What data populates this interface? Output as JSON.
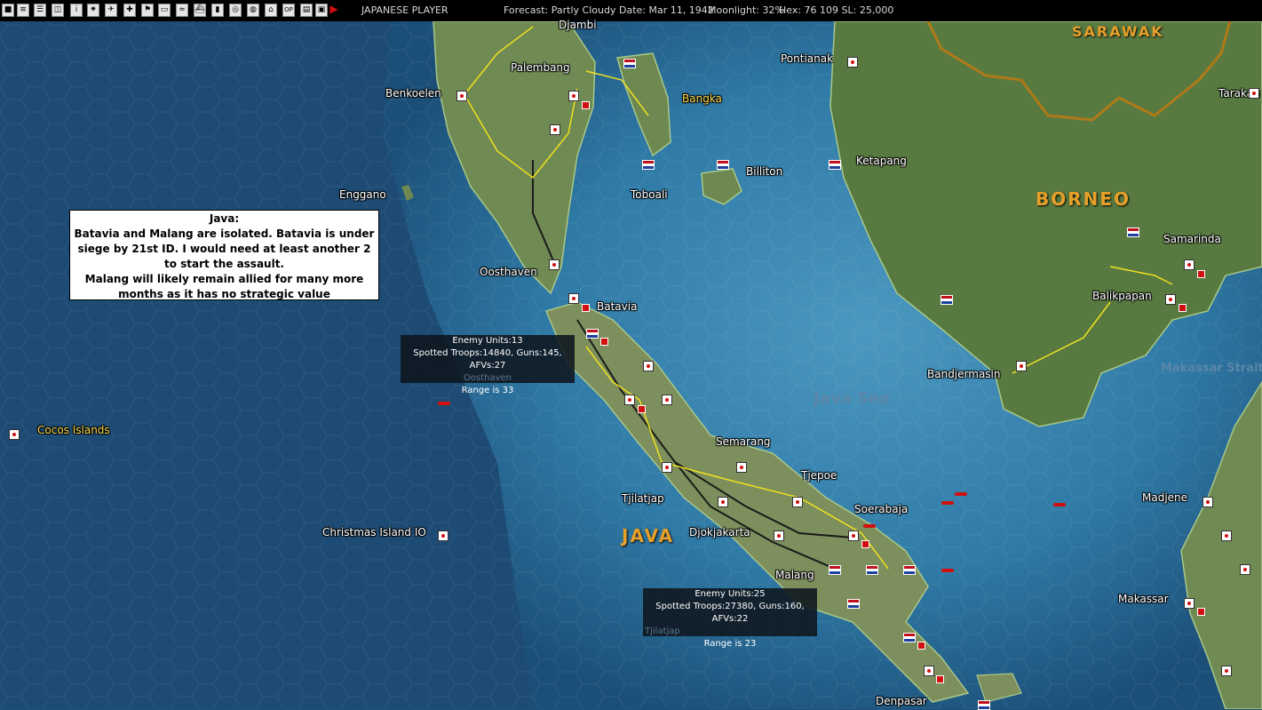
{
  "topbar": {
    "buttons": [
      "save-icon",
      "report-icon",
      "list-icon",
      "group-icon",
      "info-icon",
      "burst-icon",
      "plane-icon",
      "crosshair-icon",
      "flag-icon",
      "tank-icon",
      "path-icon",
      "ship-icon",
      "fuel-icon",
      "map-icon",
      "globe-icon",
      "nav-icon",
      "op-icon",
      "log-icon",
      "screen-icon",
      "end-turn-icon"
    ],
    "player": "JAPANESE PLAYER",
    "forecast": "Forecast: Partly Cloudy",
    "date": "Date: Mar 11, 1942",
    "moonlight": "Moonlight: 32%",
    "hex": "Hex: 76 109  SL: 25,000",
    "op_label": "OP"
  },
  "map": {
    "places": {
      "djambi": "Djambi",
      "palembang": "Palembang",
      "benkoelen": "Benkoelen",
      "bangka": "Bangka",
      "pontianak": "Pontianak",
      "sarawak": "SARAWAK",
      "tarakan": "Tarakan",
      "billiton": "Billiton",
      "ketapang": "Ketapang",
      "toboali": "Toboali",
      "enggano": "Enggano",
      "borneo": "BORNEO",
      "samarinda": "Samarinda",
      "oosthaven": "Oosthaven",
      "batavia": "Batavia",
      "balikpapan": "Balikpapan",
      "makassar_strait": "Makassar Strait",
      "bandjermasin": "Bandjermasin",
      "java_sea": "Java Sea",
      "cocos": "Cocos Islands",
      "semarang": "Semarang",
      "tjepoe": "Tjepoe",
      "tjilatjap": "Tjilatjap",
      "soerabaja": "Soerabaja",
      "madjene": "Madjene",
      "christmas": "Christmas Island IO",
      "djokjakarta": "Djokjakarta",
      "java": "JAVA",
      "malang": "Malang",
      "makassar": "Makassar",
      "denpasar": "Denpasar",
      "oosthaven_shadow": "Oosthaven",
      "tjilatjap_shadow": "Tjilatjap"
    },
    "colors": {
      "ocean": "#1c4f78",
      "shallow": "#3f8ab5",
      "land": "#6f8a52",
      "road": "#f0e020",
      "rail": "#1a1a1a",
      "border": "#b07a18"
    }
  },
  "note": {
    "title": "Java:",
    "line1": "Batavia and Malang are isolated. Batavia is under",
    "line2": "siege by 21st ID. I would need at least another 2",
    "line3": "to start the assault.",
    "line4": "Malang will likely remain allied for many more",
    "line5": "months as it has no strategic value"
  },
  "intel_batavia": {
    "enemy": "Enemy Units:13",
    "spotted": "Spotted Troops:14840, Guns:145, AFVs:27",
    "range": "Range is 33"
  },
  "intel_malang": {
    "enemy": "Enemy Units:25",
    "spotted": "Spotted Troops:27380, Guns:160, AFVs:22",
    "range": "Range is 23"
  }
}
